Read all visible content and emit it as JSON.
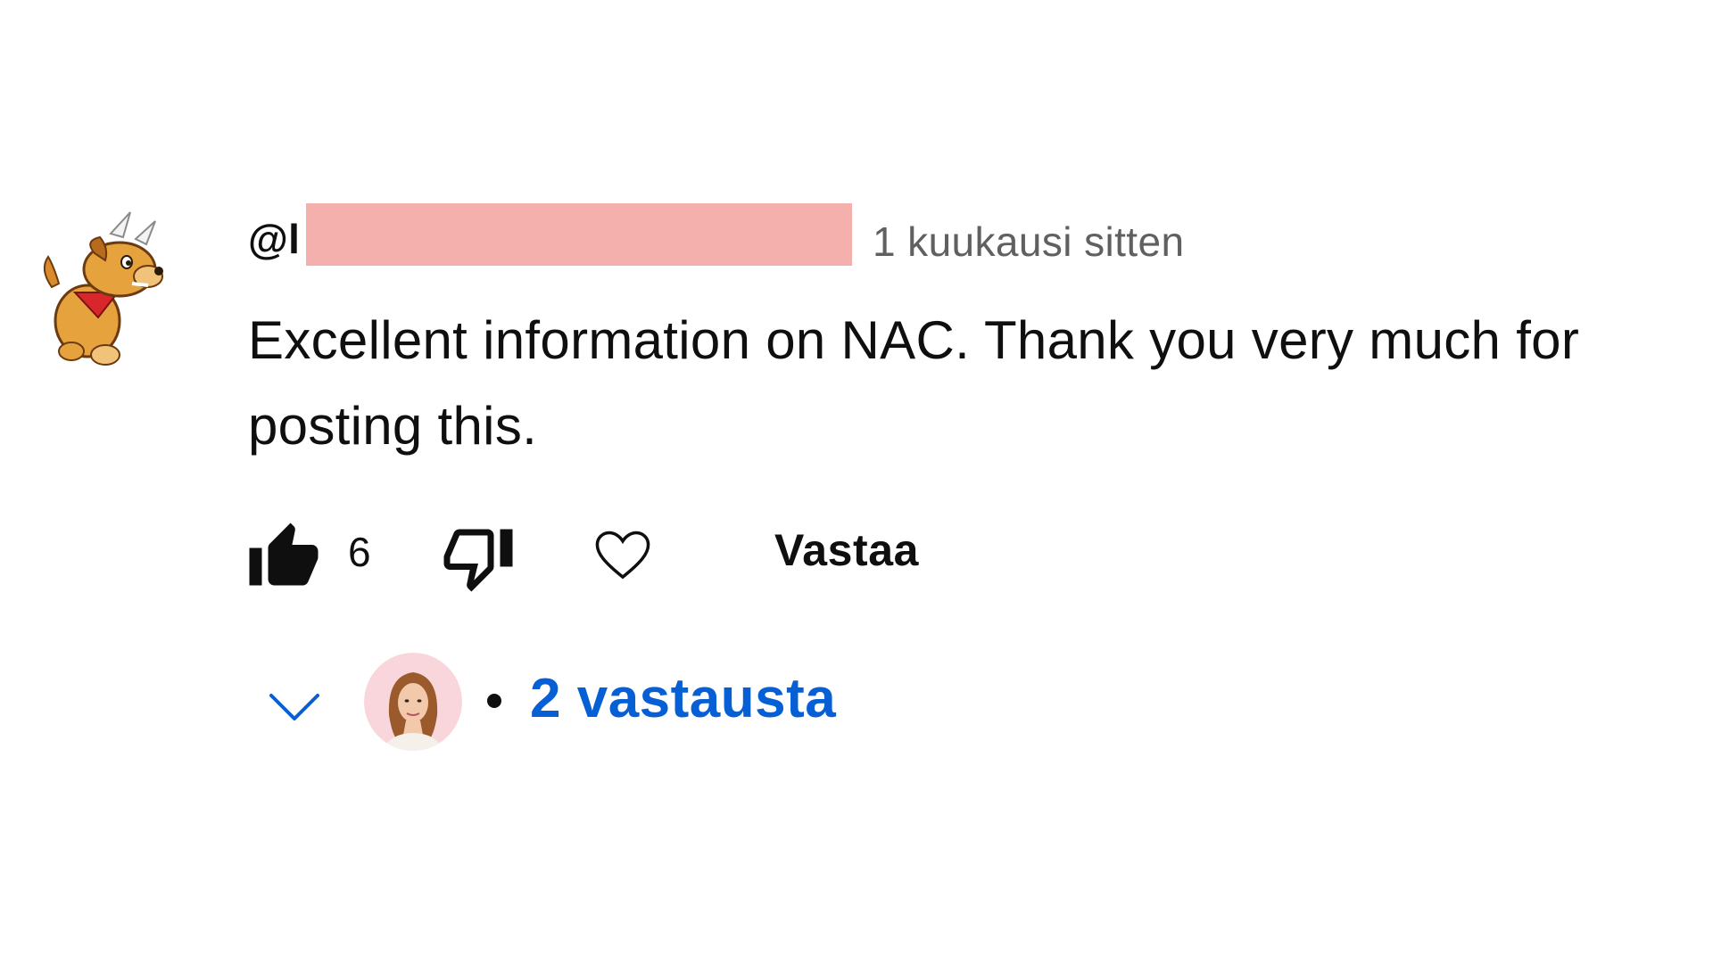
{
  "comment": {
    "author_visible_prefix": "@",
    "author_visible_initial": "l",
    "timestamp": "1 kuukausi sitten",
    "text": "Excellent information on NAC. Thank you very much for posting this.",
    "author_avatar_icon": "cartoon-dog-icon"
  },
  "actions": {
    "like_icon": "thumbs-up-filled-icon",
    "like_count": "6",
    "dislike_icon": "thumbs-down-outline-icon",
    "heart_icon": "heart-outline-icon",
    "reply_label": "Vastaa"
  },
  "replies": {
    "expand_icon": "chevron-down-icon",
    "replier_avatar_icon": "person-avatar-icon",
    "label": "2 vastausta"
  },
  "colors": {
    "text_primary": "#0f0f0f",
    "text_secondary": "#606060",
    "link_blue": "#065fd4",
    "redaction": "#f4b0ad",
    "background": "#ffffff"
  }
}
